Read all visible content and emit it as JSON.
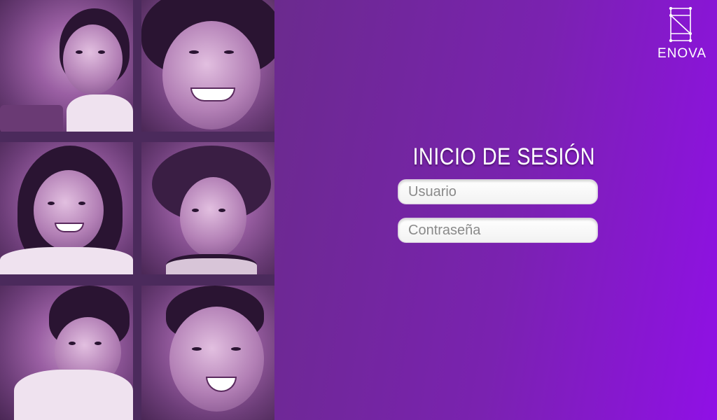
{
  "brand": {
    "logo_text": "ENOVA",
    "logo_icon": "enova-logo-icon"
  },
  "login": {
    "title": "INICIO DE SESIÓN",
    "username_placeholder": "Usuario",
    "password_placeholder": "Contraseña"
  },
  "photos": [
    {
      "name": "photo-girl-writing"
    },
    {
      "name": "photo-smiling-girl"
    },
    {
      "name": "photo-girl-with-bow"
    },
    {
      "name": "photo-boy-with-hat"
    },
    {
      "name": "photo-girl-at-desk"
    },
    {
      "name": "photo-laughing-boy"
    }
  ],
  "colors": {
    "background_start": "#5a2e73",
    "background_end": "#9010e6",
    "title": "#ffffff",
    "field_background": "#ffffff"
  }
}
